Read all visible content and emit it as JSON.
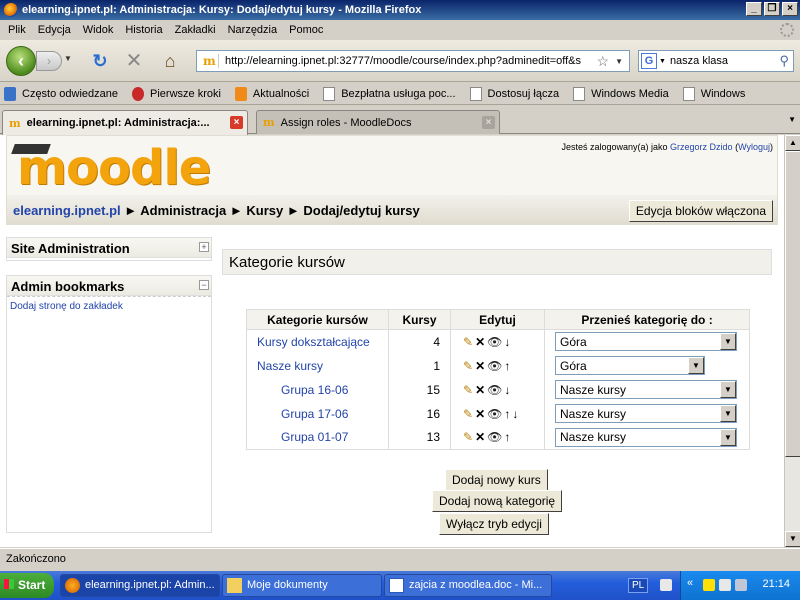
{
  "window": {
    "title": "elearning.ipnet.pl: Administracja: Kursy: Dodaj/edytuj kursy - Mozilla Firefox"
  },
  "menu": [
    "Plik",
    "Edycja",
    "Widok",
    "Historia",
    "Zakładki",
    "Narzędzia",
    "Pomoc"
  ],
  "nav": {
    "url": "http://elearning.ipnet.pl:32777/moodle/course/index.php?adminedit=off&s",
    "search_value": "nasza klasa"
  },
  "bookmarks": [
    {
      "label": "Często odwiedzane",
      "icon": "bookmark-folder-icon"
    },
    {
      "label": "Pierwsze kroki",
      "icon": "firefox-bookmark-icon"
    },
    {
      "label": "Aktualności",
      "icon": "rss-icon"
    },
    {
      "label": "Bezpłatna usługa poc...",
      "icon": "page-icon"
    },
    {
      "label": "Dostosuj łącza",
      "icon": "page-icon"
    },
    {
      "label": "Windows Media",
      "icon": "page-icon"
    },
    {
      "label": "Windows",
      "icon": "page-icon"
    }
  ],
  "tabs": [
    {
      "label": "elearning.ipnet.pl: Administracja:...",
      "active": true
    },
    {
      "label": "Assign roles - MoodleDocs",
      "active": false
    }
  ],
  "page": {
    "logo": "moodle",
    "login_prefix": "Jesteś zalogowany(a) jako",
    "login_user": "Grzegorz Dzido",
    "logout": "Wyloguj",
    "breadcrumb": {
      "home": "elearning.ipnet.pl",
      "sep": "►",
      "items": [
        "Administracja",
        "Kursy",
        "Dodaj/edytuj kursy"
      ]
    },
    "edit_blocks_button": "Edycja bloków włączona",
    "sidebar": {
      "site_admin_title": "Site Administration",
      "admin_bookmarks_title": "Admin bookmarks",
      "add_bookmark_link": "Dodaj stronę do zakładek"
    },
    "main_heading": "Kategorie kursów",
    "table": {
      "headers": [
        "Kategorie kursów",
        "Kursy",
        "Edytuj",
        "Przenieś kategorię do :"
      ],
      "rows": [
        {
          "name": "Kursy dokształcające",
          "count": "4",
          "indent": false,
          "up": false,
          "down": true,
          "move_to": "Góra"
        },
        {
          "name": "Nasze kursy",
          "count": "1",
          "indent": false,
          "up": true,
          "down": false,
          "move_to": "Góra"
        },
        {
          "name": "Grupa 16-06",
          "count": "15",
          "indent": true,
          "up": false,
          "down": true,
          "move_to": "Nasze kursy"
        },
        {
          "name": "Grupa 17-06",
          "count": "16",
          "indent": true,
          "up": true,
          "down": true,
          "move_to": "Nasze kursy"
        },
        {
          "name": "Grupa 01-07",
          "count": "13",
          "indent": true,
          "up": true,
          "down": false,
          "move_to": "Nasze kursy"
        }
      ]
    },
    "buttons": {
      "add_course": "Dodaj nowy kurs",
      "add_category": "Dodaj nową kategorię",
      "edit_off": "Wyłącz tryb edycji"
    }
  },
  "status_text": "Zakończono",
  "taskbar": {
    "start": "Start",
    "tasks": [
      {
        "label": "elearning.ipnet.pl: Admin...",
        "active": true
      },
      {
        "label": "Moje dokumenty",
        "active": false
      },
      {
        "label": "zajcia z moodlea.doc - Mi...",
        "active": false
      }
    ],
    "lang": "PL",
    "clock": "21:14"
  }
}
